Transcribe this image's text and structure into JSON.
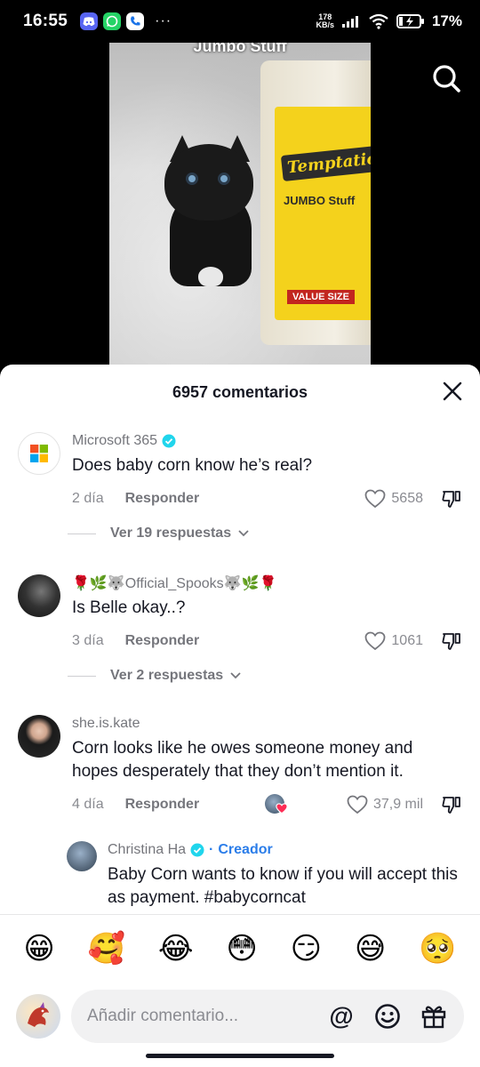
{
  "status_bar": {
    "time": "16:55",
    "network_speed_value": "178",
    "network_speed_unit": "KB/s",
    "battery": "17%",
    "app_icons": [
      "discord-icon",
      "whatsapp-icon",
      "phone-icon"
    ],
    "more": "···"
  },
  "video": {
    "top_caption": "Jumbo Stuff",
    "jar_brand": "Temptations",
    "jar_sub": "JUMBO Stuff",
    "jar_value": "VALUE SIZE"
  },
  "sheet": {
    "title": "6957 comentarios"
  },
  "comments": [
    {
      "name": "Microsoft 365",
      "verified": true,
      "text": "Does baby corn know he’s real?",
      "age": "2 día",
      "reply_label": "Responder",
      "likes": "5658",
      "view_replies": "Ver 19 respuestas"
    },
    {
      "name": "🌹🌿🐺Official_Spooks🐺🌿🌹",
      "verified": false,
      "text": "Is Belle okay..?",
      "age": "3 día",
      "reply_label": "Responder",
      "likes": "1061",
      "view_replies": "Ver 2 respuestas"
    },
    {
      "name": "she.is.kate",
      "verified": false,
      "text": "Corn looks like he owes someone money and hopes desperately that they don’t mention it.",
      "age": "4 día",
      "reply_label": "Responder",
      "likes": "37,9 mil"
    }
  ],
  "creator_reply": {
    "name": "Christina Ha",
    "separator": "·",
    "tag": "Creador",
    "text": "Baby Corn wants to know if you will accept this as payment. #babycorncat"
  },
  "emojis": [
    "😁",
    "🥰",
    "😂",
    "😳",
    "😏",
    "😅",
    "🥺"
  ],
  "composer": {
    "placeholder": "Añadir comentario...",
    "mention_symbol": "@"
  },
  "colors": {
    "creator_blue": "#2b7de9",
    "verified_blue": "#20d5ec",
    "text_dark": "#161823",
    "text_gray": "#75767c"
  }
}
